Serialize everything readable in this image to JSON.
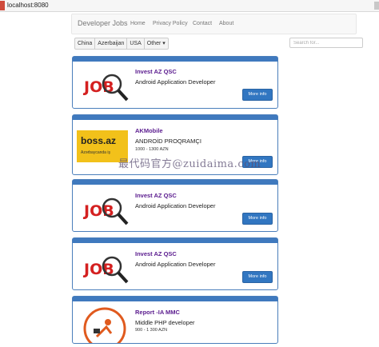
{
  "browser": {
    "url": "localhost:8080"
  },
  "navbar": {
    "brand": "Developer Jobs",
    "links": [
      "Home",
      "Privacy Policy",
      "Contact",
      "About"
    ]
  },
  "filters": {
    "countries": [
      "China",
      "Azerbaijan",
      "USA"
    ],
    "other": "Other ▾",
    "search_placeholder": "Search for..."
  },
  "jobs": [
    {
      "company": "Invest AZ QSC",
      "title": "Android Application Developer",
      "salary": "",
      "logo": "job-search-logo",
      "button": "More info"
    },
    {
      "company": "AKMobile",
      "title": "ANDROİD PROQRAMÇI",
      "salary": "1000 - 1300 AZN",
      "logo": "boss-az-logo",
      "logo_text": "boss.az",
      "logo_subtext": "Azərbaycanda iş",
      "button": "More info"
    },
    {
      "company": "Invest AZ QSC",
      "title": "Android Application Developer",
      "salary": "",
      "logo": "job-search-logo",
      "button": "More info"
    },
    {
      "company": "Invest AZ QSC",
      "title": "Android Application Developer",
      "salary": "",
      "logo": "job-search-logo",
      "button": "More info"
    },
    {
      "company": "Report -IA MMC",
      "title": "Middle PHP developer",
      "salary": "900 - 1 300 AZN",
      "logo": "report-logo",
      "button": "More info"
    }
  ],
  "watermark": "最代码官方@zuidaima.com",
  "colors": {
    "panel_header": "#3f79be",
    "button": "#3176c1",
    "company_text": "#5a1b8e"
  }
}
